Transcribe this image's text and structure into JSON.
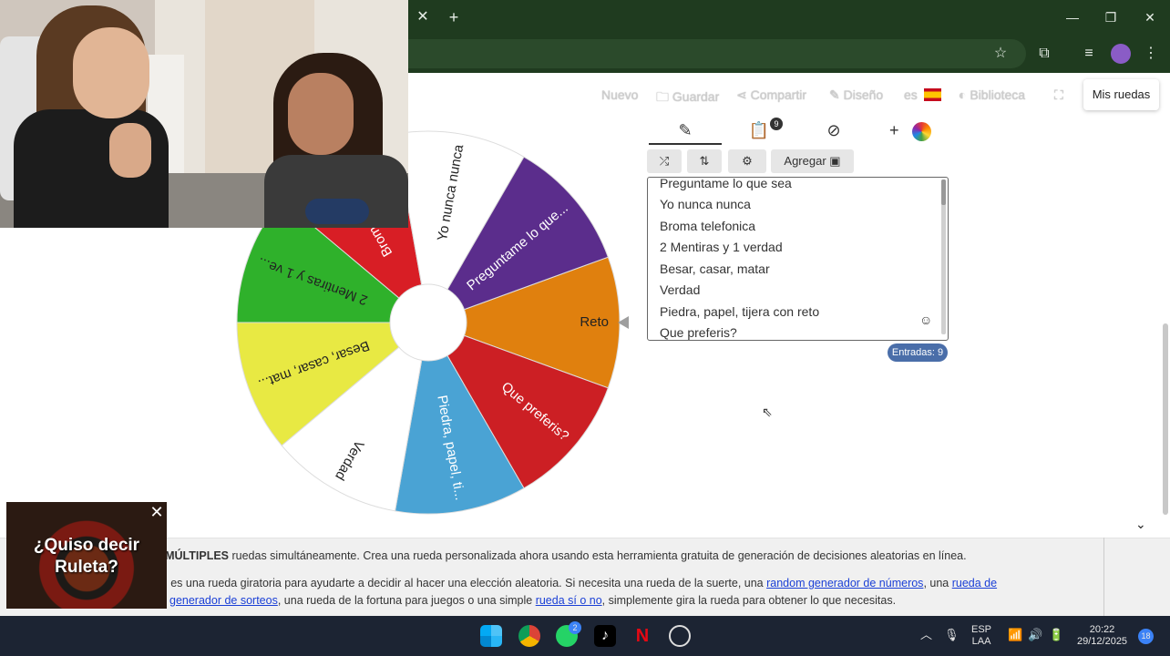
{
  "browser": {
    "icons": [
      "close-icon",
      "new-tab-icon",
      "minimize-icon",
      "maximize-icon",
      "window-close-icon",
      "star-icon",
      "extensions-icon",
      "media-icon",
      "profile-avatar",
      "menu-dots-icon"
    ]
  },
  "site_nav": {
    "nuevo": "Nuevo",
    "guardar": "Guardar",
    "compartir": "Compartir",
    "diseno": "Diseño",
    "lang": "es",
    "biblioteca": "Biblioteca",
    "mis_ruedas": "Mis ruedas"
  },
  "wheel": {
    "slices": [
      {
        "label": "Reto",
        "color": "#e0800e",
        "text_color": "#222222"
      },
      {
        "label": "Que preferis?",
        "color": "#cc1f24",
        "text_color": "#ffffff"
      },
      {
        "label": "Piedra, papel, ti...",
        "color": "#4aa3d4",
        "text_color": "#ffffff"
      },
      {
        "label": "Verdad",
        "color": "#ffffff",
        "text_color": "#222222"
      },
      {
        "label": "Besar, casar, mat...",
        "color": "#e8e943",
        "text_color": "#222222"
      },
      {
        "label": "2 Mentiras y 1 ve...",
        "color": "#2fb12b",
        "text_color": "#222222"
      },
      {
        "label": "Broma telefonica",
        "color": "#d81e25",
        "text_color": "#ffffff"
      },
      {
        "label": "Yo nunca nunca",
        "color": "#ffffff",
        "text_color": "#222222"
      },
      {
        "label": "Preguntame lo que...",
        "color": "#5b2d8c",
        "text_color": "#ffffff"
      }
    ]
  },
  "panel": {
    "tabs": [
      "edit-icon",
      "clipboard-icon",
      "hide-icon",
      "add-color-icon"
    ],
    "clipboard_badge": "9",
    "actions": {
      "agregar": "Agregar"
    },
    "entries": [
      "Preguntame lo que sea",
      "Yo nunca nunca",
      "Broma telefonica",
      "2 Mentiras y 1 verdad",
      "Besar, casar, matar",
      "Verdad",
      "Piedra, papel, tijera con reto",
      "Que preferis?"
    ],
    "entry_count_label": "Entradas: 9"
  },
  "info": {
    "line1_bold": "o MÚLTIPLES",
    "line1_rest": " ruedas simultáneamente. Crea una rueda personalizada ahora usando esta herramienta gratuita de generación de decisiones aleatorias en línea.",
    "line2_a": "el es una rueda giratoria para ayudarte a decidir al hacer una elección aleatoria. Si necesita una rueda de la suerte, una ",
    "line2_link1": "random generador de números",
    "line2_b": ", una ",
    "line2_link2": "rueda de",
    "line3_link1": "generador de sorteos",
    "line3_a": ", una rueda de la fortuna para juegos o una simple ",
    "line3_link2": "rueda sí o no",
    "line3_b": ", simplemente gira la rueda para obtener lo que necesitas."
  },
  "ad": {
    "title_line1": "¿Quiso decir",
    "title_line2": "Ruleta?"
  },
  "taskbar": {
    "whatsapp_badge": "2",
    "lang_line1": "ESP",
    "lang_line2": "LAA",
    "time": "20:22",
    "date": "29/12/2025",
    "notif": "18"
  }
}
